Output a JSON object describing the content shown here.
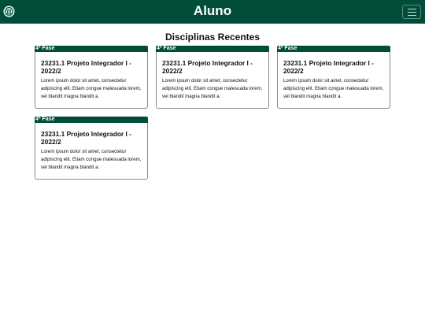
{
  "navbar": {
    "title": "Aluno",
    "logo_icon": "university-seal-icon",
    "menu_icon": "hamburger-menu-icon",
    "brand_color": "#004d3a"
  },
  "main": {
    "section_title": "Disciplinas Recentes",
    "cards": [
      {
        "badge": "4ª Fase",
        "title": "23231.1 Projeto Integrador I - 2022/2",
        "text": "Lorem ipsum dolor sit amet, consectetur adipiscing elit. Etiam congue malesuada lorem, vel blandit magna blandit a."
      },
      {
        "badge": "4ª Fase",
        "title": "23231.1 Projeto Integrador I - 2022/2",
        "text": "Lorem ipsum dolor sit amet, consectetur adipiscing elit. Etiam congue malesuada lorem, vel blandit magna blandit a."
      },
      {
        "badge": "4ª Fase",
        "title": "23231.1 Projeto Integrador I - 2022/2",
        "text": "Lorem ipsum dolor sit amet, consectetur adipiscing elit. Etiam congue malesuada lorem, vel blandit magna blandit a."
      },
      {
        "badge": "4ª Fase",
        "title": "23231.1 Projeto Integrador I - 2022/2",
        "text": "Lorem ipsum dolor sit amet, consectetur adipiscing elit. Etiam congue malesuada lorem, vel blandit magna blandit a."
      }
    ]
  }
}
